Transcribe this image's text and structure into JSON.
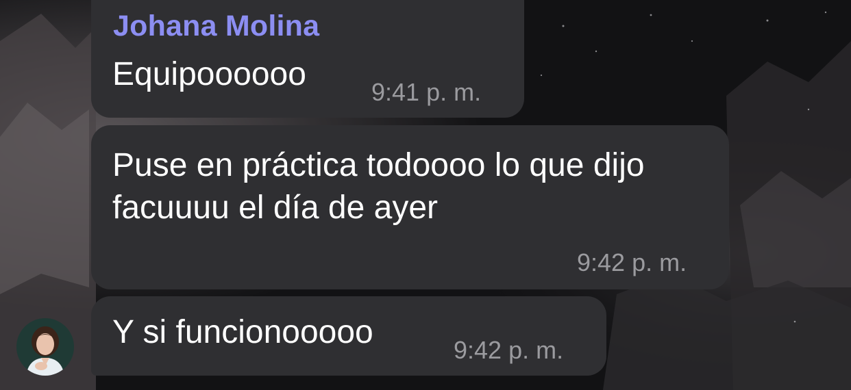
{
  "conversation": {
    "messages": [
      {
        "sender": "Johana Molina",
        "text": "Equipoooooo",
        "time": "9:41 p. m."
      },
      {
        "text": "Puse en práctica todoooo lo que dijo facuuuu el día de ayer",
        "time": "9:42 p. m."
      },
      {
        "text": "Y si funcionooooo",
        "time": "9:42 p. m."
      }
    ]
  },
  "colors": {
    "background": "#121214",
    "bubble": "#2f2f32",
    "sender_name": "#8c8ef2",
    "message_text": "#ffffff",
    "timestamp": "#9b9b9f"
  },
  "icons": {
    "avatar": "profile-photo"
  }
}
